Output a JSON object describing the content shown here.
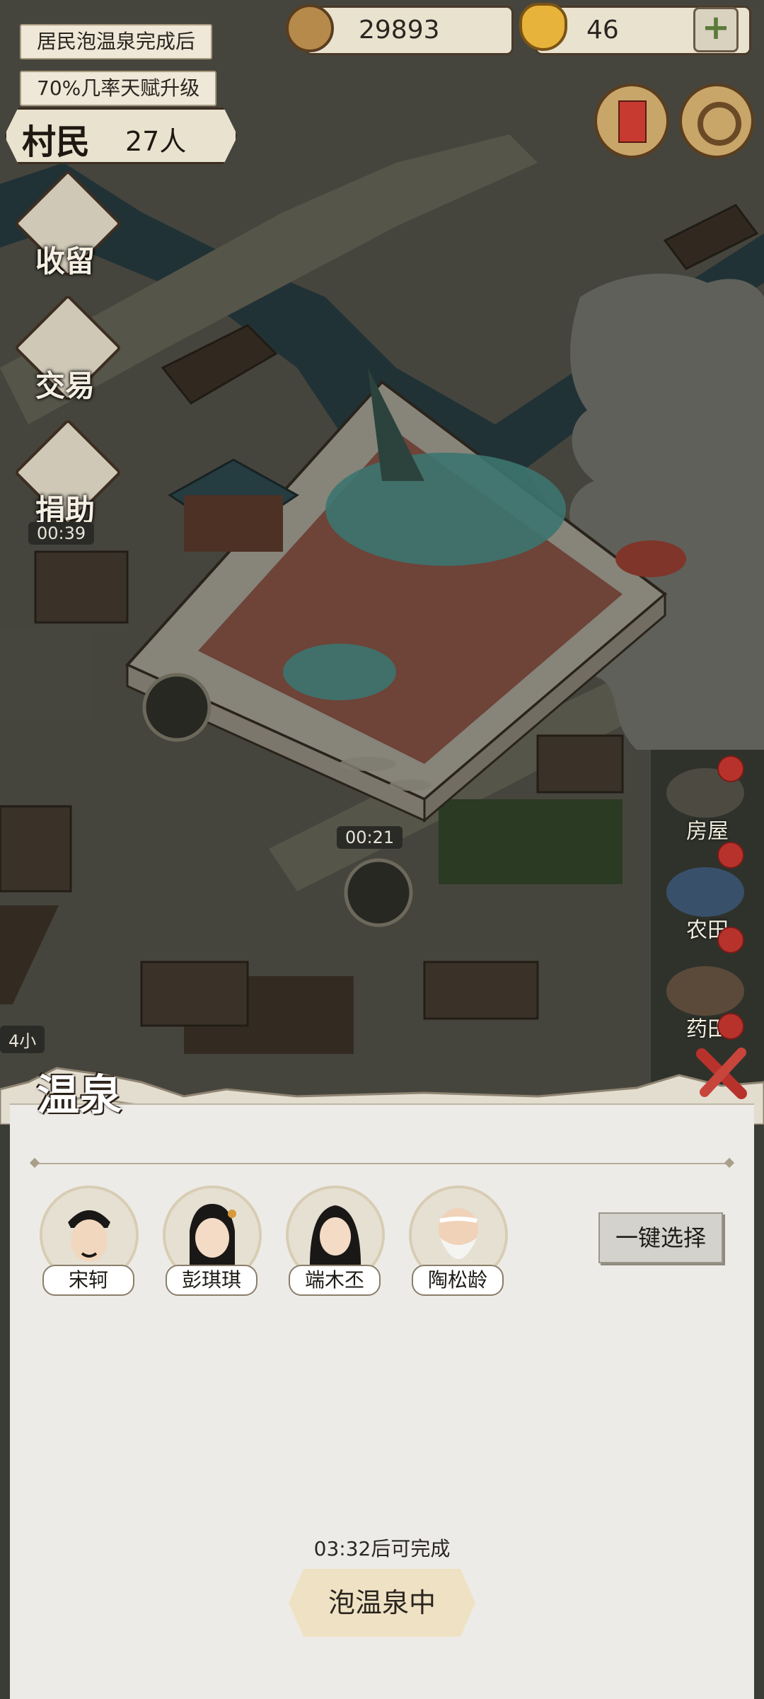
{
  "hud": {
    "notice_1": "居民泡温泉完成后",
    "notice_2": "70%几率天赋升级",
    "coins": "29893",
    "gold": "46",
    "villager_label": "村民",
    "villager_count": "27人"
  },
  "side_menu": {
    "shelter": "收留",
    "trade": "交易",
    "donate": "捐助",
    "donate_timer": "00:39"
  },
  "map": {
    "building_timer": "00:21",
    "left_tag": "4小"
  },
  "right_menu": {
    "house": "房屋",
    "farm": "农田",
    "herb": "药田"
  },
  "panel": {
    "title": "温泉",
    "residents": [
      {
        "name": "宋轲"
      },
      {
        "name": "彭琪琪"
      },
      {
        "name": "端木丕"
      },
      {
        "name": "陶松龄"
      }
    ],
    "one_key_select": "一键选择",
    "countdown": "03:32后可完成",
    "action": "泡温泉中"
  },
  "colors": {
    "panel_bg": "#edebe7",
    "accent_red": "#b8322c",
    "hud_bg": "#e9e2cf"
  }
}
